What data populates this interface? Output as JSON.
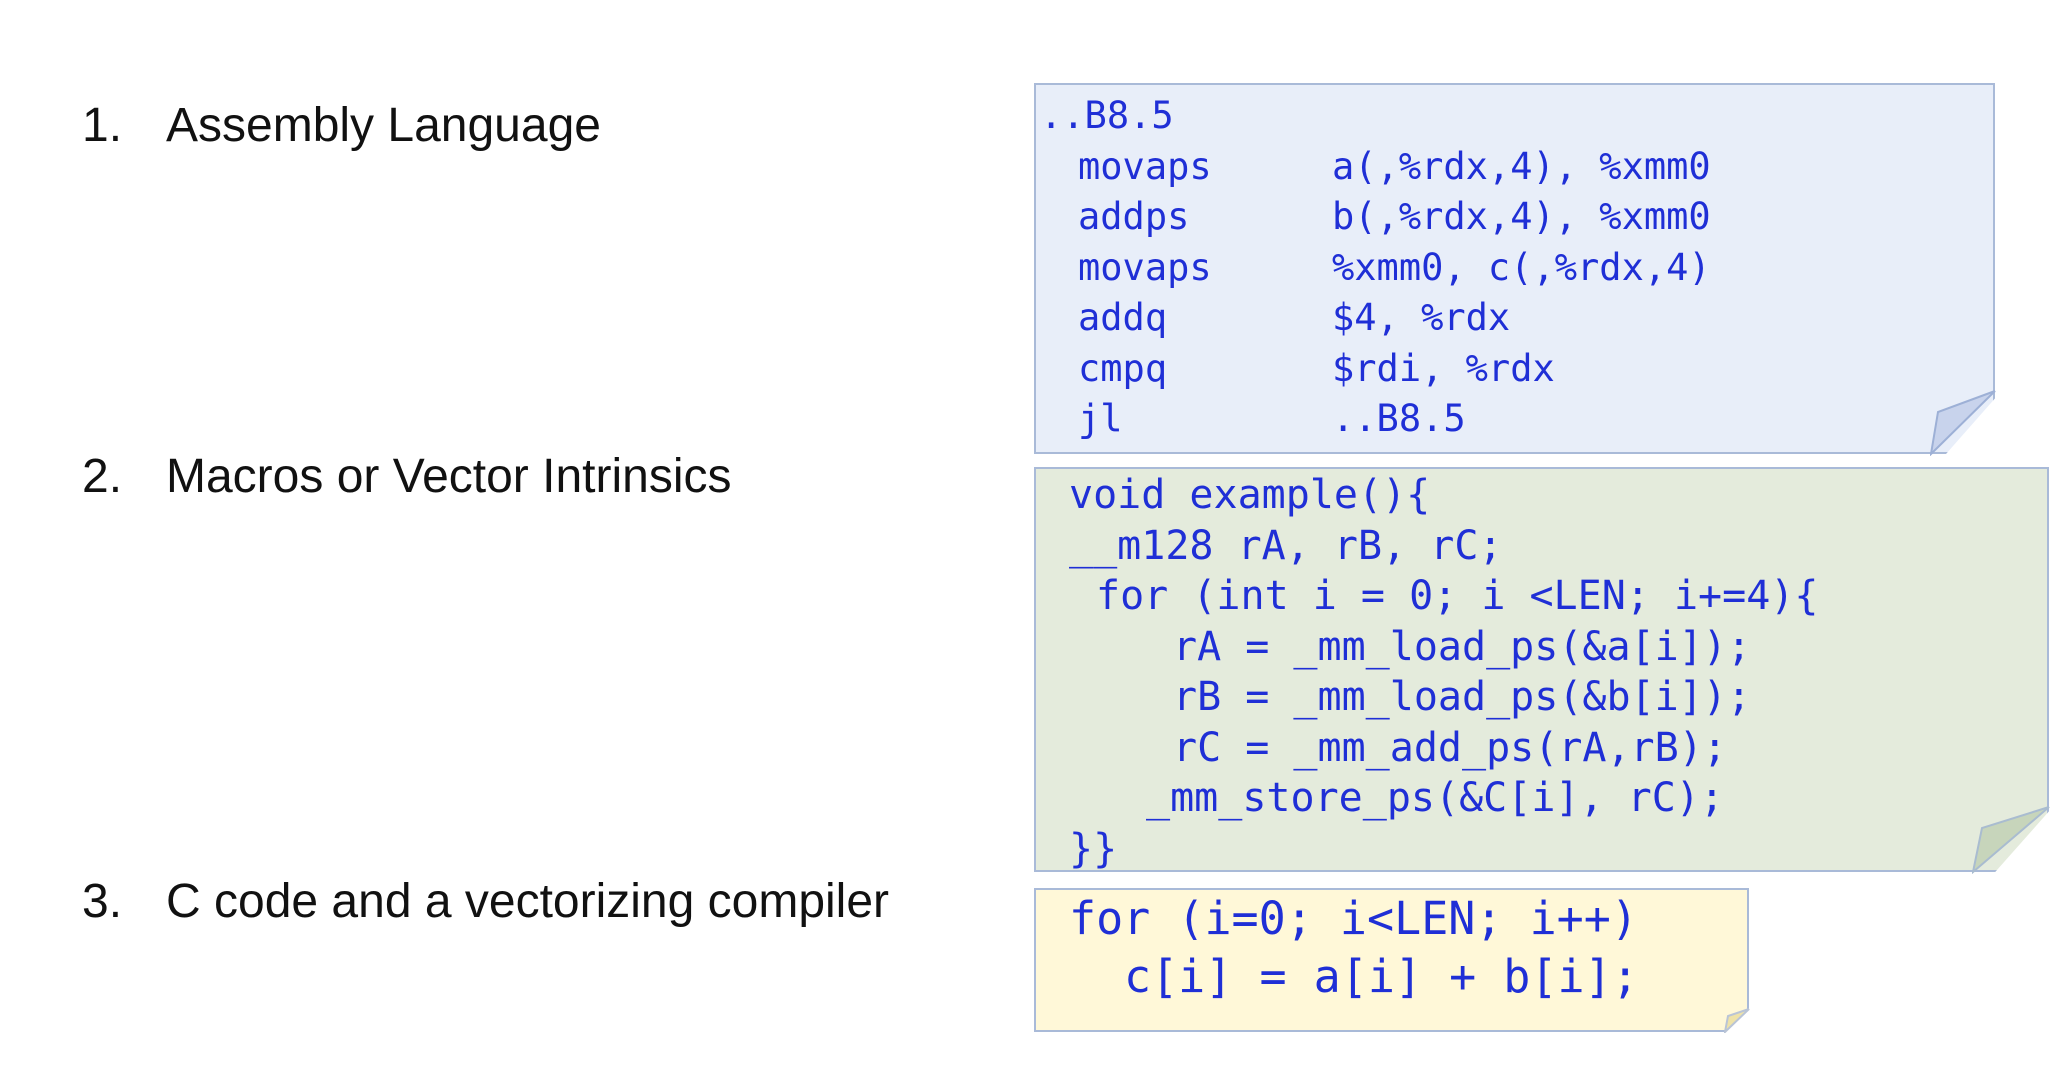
{
  "list": [
    {
      "number": "1.",
      "label": "Assembly Language"
    },
    {
      "number": "2.",
      "label": "Macros or Vector Intrinsics"
    },
    {
      "number": "3.",
      "label": "C code and a vectorizing compiler"
    }
  ],
  "assembly": {
    "label": "..B8.5",
    "rows": [
      {
        "op": "movaps",
        "args": "a(,%rdx,4), %xmm0"
      },
      {
        "op": "addps",
        "args": "b(,%rdx,4), %xmm0"
      },
      {
        "op": "movaps",
        "args": "%xmm0, c(,%rdx,4)"
      },
      {
        "op": "addq",
        "args": "$4, %rdx"
      },
      {
        "op": "cmpq",
        "args": "$rdi, %rdx"
      },
      {
        "op": "jl",
        "args": "..B8.5"
      }
    ]
  },
  "intrinsics": {
    "lines": [
      "void example(){",
      "__m128 rA, rB, rC;",
      "for (int i = 0; i <LEN; i+=4){",
      "rA = _mm_load_ps(&a[i]);",
      "rB = _mm_load_ps(&b[i]);",
      "rC = _mm_add_ps(rA,rB);",
      "_mm_store_ps(&C[i], rC);",
      "}}"
    ]
  },
  "c_code": {
    "lines": [
      "for (i=0; i<LEN; i++)",
      "c[i] = a[i] + b[i];"
    ]
  },
  "colors": {
    "code_text": "#1f2fd6",
    "assembly_bg": "#e8eef9",
    "intrinsics_bg": "#e4ebdc",
    "c_bg": "#fff8d8"
  }
}
